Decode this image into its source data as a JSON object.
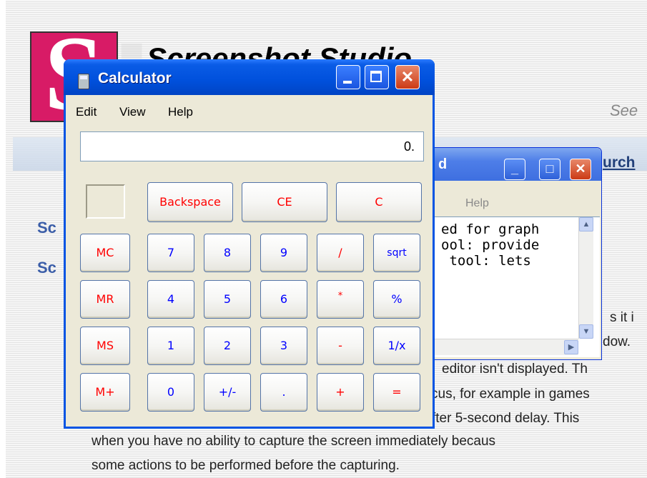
{
  "background_page": {
    "site_title": "Screenshot Studio",
    "tagline": "See",
    "nav_link": "urch",
    "sidebar_heading_1": "Sc",
    "sidebar_heading_2": "Sc",
    "text_fragments": [
      "s it i",
      "dow.",
      "editor isn't displayed. Th",
      "cus, for example in games",
      "fter 5-second delay. This",
      "when you have no ability to capture the screen immediately becaus",
      "some actions to be performed before the capturing."
    ]
  },
  "notepad": {
    "title": "d",
    "menu": {
      "help": "Help"
    },
    "text_lines": [
      "ed for graph",
      "ool: provide",
      " tool: lets"
    ],
    "buttons": {
      "minimize": "_",
      "maximize": "□",
      "close": "✕"
    }
  },
  "calculator": {
    "title": "Calculator",
    "icon": "calculator-icon",
    "menu": {
      "edit": "Edit",
      "view": "View",
      "help": "Help"
    },
    "display": "0.",
    "title_buttons": {
      "close": "✕"
    },
    "top_row": {
      "backspace": "Backspace",
      "ce": "CE",
      "c": "C"
    },
    "memory": {
      "mc": "MC",
      "mr": "MR",
      "ms": "MS",
      "mplus": "M+"
    },
    "rows": [
      [
        "7",
        "8",
        "9",
        "/",
        "sqrt"
      ],
      [
        "4",
        "5",
        "6",
        "*",
        "%"
      ],
      [
        "1",
        "2",
        "3",
        "-",
        "1/x"
      ],
      [
        "0",
        "+/-",
        ".",
        "+",
        "="
      ]
    ]
  },
  "colors": {
    "title_bar_blue": "#0050dc",
    "close_button_red": "#cc3a15",
    "digit_blue": "#0000ff",
    "operator_red": "#ff0000",
    "logo_magenta": "#d81b66"
  }
}
